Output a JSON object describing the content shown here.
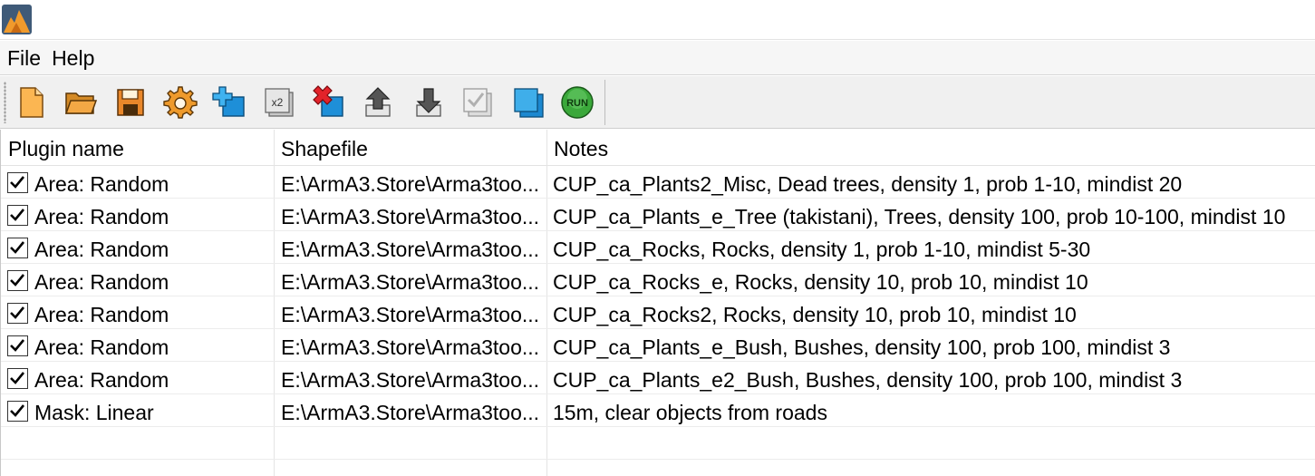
{
  "menu": {
    "file": "File",
    "help": "Help"
  },
  "toolbar": {
    "buttons": [
      {
        "icon": "new-file-icon"
      },
      {
        "icon": "open-folder-icon"
      },
      {
        "icon": "save-icon"
      },
      {
        "icon": "gear-icon"
      },
      {
        "icon": "add-icon"
      },
      {
        "icon": "duplicate-x2-icon",
        "label": "x2"
      },
      {
        "icon": "remove-icon"
      },
      {
        "icon": "move-up-icon"
      },
      {
        "icon": "move-down-icon"
      },
      {
        "icon": "checked-stack-icon"
      },
      {
        "icon": "layers-icon"
      },
      {
        "icon": "run-icon",
        "label": "RUN"
      }
    ]
  },
  "table": {
    "headers": {
      "plugin": "Plugin name",
      "shapefile": "Shapefile",
      "notes": "Notes"
    },
    "rows": [
      {
        "checked": true,
        "plugin": "Area: Random",
        "shapefile": "E:\\ArmA3.Store\\Arma3too...",
        "notes": "CUP_ca_Plants2_Misc, Dead trees, density 1, prob 1-10, mindist 20"
      },
      {
        "checked": true,
        "plugin": "Area: Random",
        "shapefile": "E:\\ArmA3.Store\\Arma3too...",
        "notes": "CUP_ca_Plants_e_Tree (takistani), Trees, density 100, prob 10-100, mindist 10"
      },
      {
        "checked": true,
        "plugin": "Area: Random",
        "shapefile": "E:\\ArmA3.Store\\Arma3too...",
        "notes": "CUP_ca_Rocks, Rocks, density 1, prob 1-10, mindist 5-30"
      },
      {
        "checked": true,
        "plugin": "Area: Random",
        "shapefile": "E:\\ArmA3.Store\\Arma3too...",
        "notes": "CUP_ca_Rocks_e, Rocks, density 10, prob 10, mindist 10"
      },
      {
        "checked": true,
        "plugin": "Area: Random",
        "shapefile": "E:\\ArmA3.Store\\Arma3too...",
        "notes": "CUP_ca_Rocks2, Rocks, density 10, prob 10, mindist 10"
      },
      {
        "checked": true,
        "plugin": "Area: Random",
        "shapefile": "E:\\ArmA3.Store\\Arma3too...",
        "notes": "CUP_ca_Plants_e_Bush, Bushes, density 100, prob 100, mindist 3"
      },
      {
        "checked": true,
        "plugin": "Area: Random",
        "shapefile": "E:\\ArmA3.Store\\Arma3too...",
        "notes": "CUP_ca_Plants_e2_Bush, Bushes, density 100, prob 100, mindist 3"
      },
      {
        "checked": true,
        "plugin": "Mask: Linear",
        "shapefile": "E:\\ArmA3.Store\\Arma3too...",
        "notes": "15m, clear objects from roads"
      }
    ]
  }
}
